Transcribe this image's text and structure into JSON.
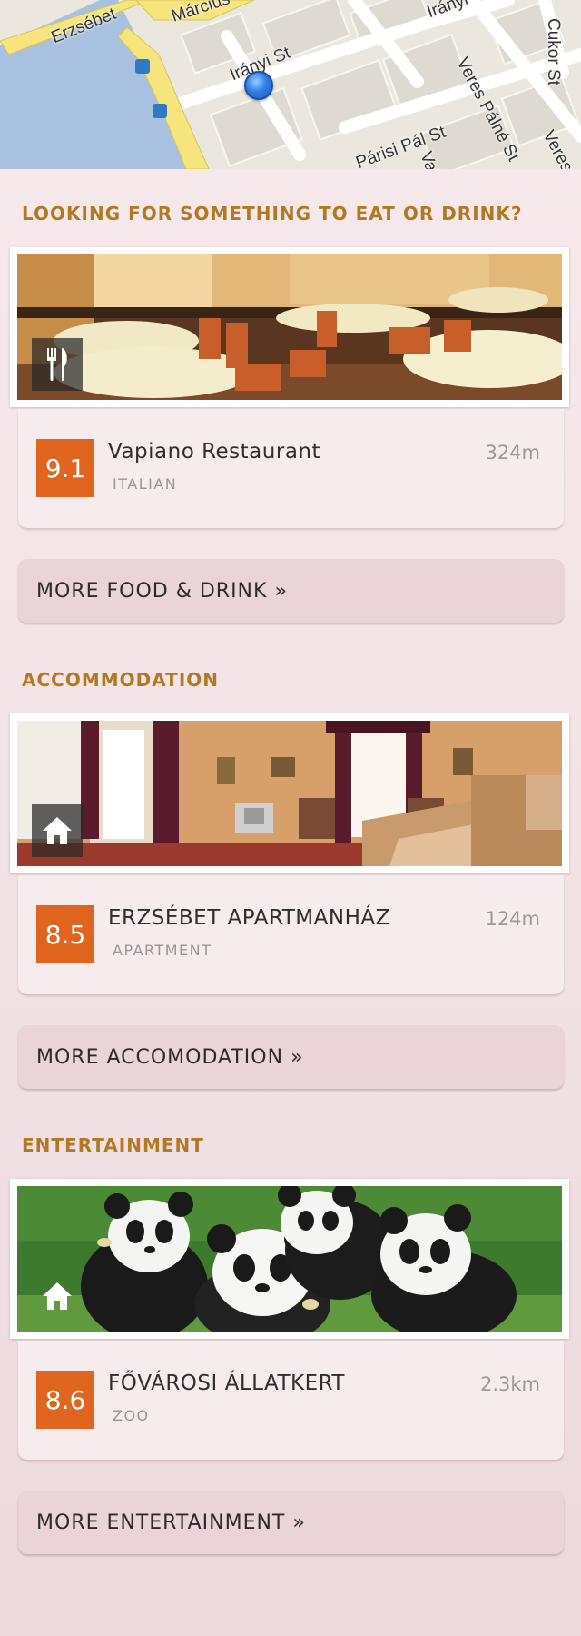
{
  "map": {
    "streets": [
      "Erzsébet",
      "Március",
      "Irányi St",
      "Irányi",
      "Veres Pálné St",
      "Cukor St",
      "Veres",
      "Párisi Pál St",
      "Va"
    ]
  },
  "sections": [
    {
      "title": "LOOKING FOR SOMETHING TO EAT OR DRINK?",
      "icon": "fork-knife-icon",
      "venue": {
        "score": "9.1",
        "name": "Vapiano Restaurant",
        "category": "ITALIAN",
        "distance": "324m"
      },
      "more_label": "MORE FOOD & DRINK »"
    },
    {
      "title": "ACCOMMODATION",
      "icon": "home-icon",
      "venue": {
        "score": "8.5",
        "name": "ERZSÉBET APARTMANHÁZ",
        "category": "APARTMENT",
        "distance": "124m"
      },
      "more_label": "MORE ACCOMODATION »"
    },
    {
      "title": "ENTERTAINMENT",
      "icon": "home-icon",
      "venue": {
        "score": "8.6",
        "name": "FŐVÁROSI ÁLLATKERT",
        "category": "ZOO",
        "distance": "2.3km"
      },
      "more_label": "MORE ENTERTAINMENT »"
    }
  ],
  "colors": {
    "section_title": "#b07a22",
    "score_badge": "#e0651f",
    "more_button": "#ead4d8",
    "background": "#f3e3e7"
  }
}
